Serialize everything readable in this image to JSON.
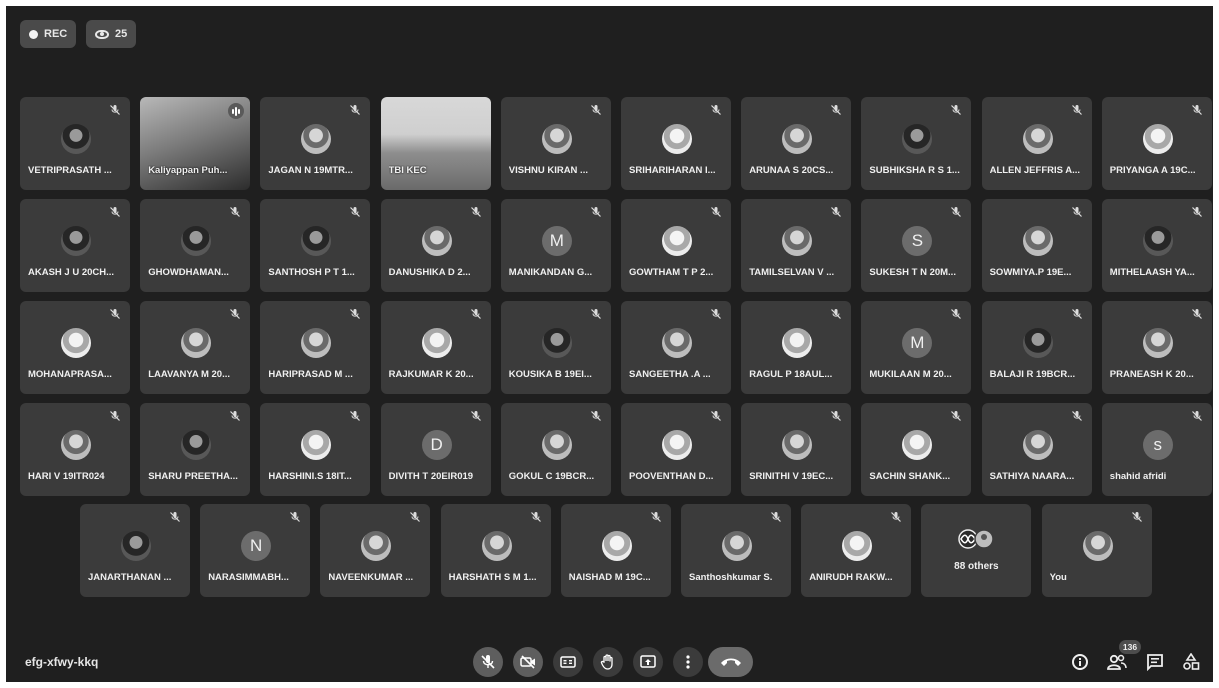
{
  "status": {
    "rec_label": "REC",
    "viewer_count": "25"
  },
  "rows": [
    [
      {
        "name": "VETRIPRASATH ...",
        "kind": "photo",
        "tone": "dark"
      },
      {
        "name": "Kaliyappan Puh...",
        "kind": "video"
      },
      {
        "name": "JAGAN N 19MTR...",
        "kind": "photo",
        "tone": "mid"
      },
      {
        "name": "TBI KEC",
        "kind": "video-room"
      },
      {
        "name": "VISHNU KIRAN ...",
        "kind": "photo",
        "tone": "mid"
      },
      {
        "name": "SRIHARIHARAN I...",
        "kind": "photo",
        "tone": "light"
      },
      {
        "name": "ARUNAA S 20CS...",
        "kind": "photo",
        "tone": "mid"
      },
      {
        "name": "SUBHIKSHA R S 1...",
        "kind": "photo",
        "tone": "dark"
      },
      {
        "name": "ALLEN JEFFRIS A...",
        "kind": "photo",
        "tone": "mid"
      },
      {
        "name": "PRIYANGA A 19C...",
        "kind": "photo",
        "tone": "light"
      }
    ],
    [
      {
        "name": "AKASH J U 20CH...",
        "kind": "photo",
        "tone": "dark"
      },
      {
        "name": "GHOWDHAMAN...",
        "kind": "photo",
        "tone": "dark"
      },
      {
        "name": "SANTHOSH P T 1...",
        "kind": "photo",
        "tone": "dark"
      },
      {
        "name": "DANUSHIKA D 2...",
        "kind": "photo",
        "tone": "mid"
      },
      {
        "name": "MANIKANDAN G...",
        "kind": "letter",
        "letter": "M"
      },
      {
        "name": "GOWTHAM T P 2...",
        "kind": "photo",
        "tone": "light"
      },
      {
        "name": "TAMILSELVAN V ...",
        "kind": "photo",
        "tone": "mid"
      },
      {
        "name": "SUKESH T N 20M...",
        "kind": "letter",
        "letter": "S"
      },
      {
        "name": "SOWMIYA.P 19E...",
        "kind": "photo",
        "tone": "mid"
      },
      {
        "name": "MITHELAASH YA...",
        "kind": "photo",
        "tone": "dark"
      }
    ],
    [
      {
        "name": "MOHANAPRASA...",
        "kind": "photo",
        "tone": "light"
      },
      {
        "name": "LAAVANYA M 20...",
        "kind": "photo",
        "tone": "mid"
      },
      {
        "name": "HARIPRASAD M ...",
        "kind": "photo",
        "tone": "mid"
      },
      {
        "name": "RAJKUMAR K 20...",
        "kind": "photo",
        "tone": "light"
      },
      {
        "name": "KOUSIKA B 19EI...",
        "kind": "photo",
        "tone": "dark"
      },
      {
        "name": "SANGEETHA .A ...",
        "kind": "photo",
        "tone": "mid"
      },
      {
        "name": "RAGUL P 18AUL...",
        "kind": "photo",
        "tone": "light"
      },
      {
        "name": "MUKILAAN M 20...",
        "kind": "letter",
        "letter": "M"
      },
      {
        "name": "BALAJI R 19BCR...",
        "kind": "photo",
        "tone": "dark"
      },
      {
        "name": "PRANEASH K 20...",
        "kind": "photo",
        "tone": "mid"
      }
    ],
    [
      {
        "name": "HARI V 19ITR024",
        "kind": "photo",
        "tone": "mid"
      },
      {
        "name": "SHARU PREETHA...",
        "kind": "photo",
        "tone": "dark"
      },
      {
        "name": "HARSHINI.S 18IT...",
        "kind": "photo",
        "tone": "light"
      },
      {
        "name": "DIVITH T 20EIR019",
        "kind": "letter",
        "letter": "D"
      },
      {
        "name": "GOKUL C 19BCR...",
        "kind": "photo",
        "tone": "mid"
      },
      {
        "name": "POOVENTHAN D...",
        "kind": "photo",
        "tone": "light"
      },
      {
        "name": "SRINITHI V 19EC...",
        "kind": "photo",
        "tone": "mid"
      },
      {
        "name": "SACHIN SHANK...",
        "kind": "photo",
        "tone": "light"
      },
      {
        "name": "SATHIYA NAARA...",
        "kind": "photo",
        "tone": "mid"
      },
      {
        "name": "shahid afridi",
        "kind": "letter",
        "letter": "s"
      }
    ],
    [
      {
        "name": "JANARTHANAN ...",
        "kind": "photo",
        "tone": "dark"
      },
      {
        "name": "NARASIMMABH...",
        "kind": "letter",
        "letter": "N"
      },
      {
        "name": "NAVEENKUMAR ...",
        "kind": "photo",
        "tone": "mid"
      },
      {
        "name": "HARSHATH S M 1...",
        "kind": "photo",
        "tone": "mid"
      },
      {
        "name": "NAISHAD M 19C...",
        "kind": "photo",
        "tone": "light"
      },
      {
        "name": "Santhoshkumar S.",
        "kind": "photo",
        "tone": "mid"
      },
      {
        "name": "ANIRUDH RAKW...",
        "kind": "photo",
        "tone": "light"
      },
      {
        "name": "88 others",
        "kind": "others"
      },
      {
        "name": "You",
        "kind": "photo",
        "tone": "mid",
        "self": true
      }
    ]
  ],
  "footer": {
    "meeting_code": "efg-xfwy-kkq",
    "participants_count": "136"
  },
  "controls": [
    {
      "id": "mic-toggle-button",
      "icon": "mic-off-icon",
      "off": true
    },
    {
      "id": "camera-toggle-button",
      "icon": "camera-off-icon",
      "off": true
    },
    {
      "id": "captions-button",
      "icon": "captions-icon"
    },
    {
      "id": "raise-hand-button",
      "icon": "hand-icon"
    },
    {
      "id": "present-button",
      "icon": "present-icon"
    },
    {
      "id": "more-options-button",
      "icon": "more-vert-icon"
    }
  ]
}
